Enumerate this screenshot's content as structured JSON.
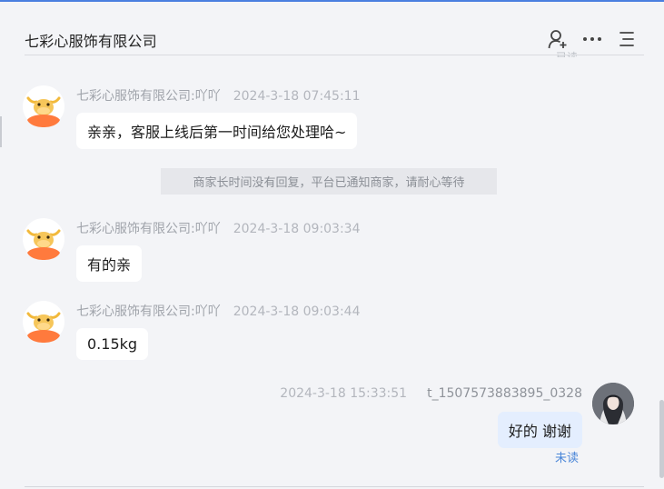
{
  "header": {
    "title": "七彩心服饰有限公司",
    "icons": [
      "add-user-icon",
      "more-icon",
      "menu-icon"
    ]
  },
  "clipped_status": "已读",
  "messages": [
    {
      "sender": "七彩心服饰有限公司:吖吖",
      "time": "2024-3-18 07:45:11",
      "text": "亲亲，客服上线后第一时间给您处理哈~"
    },
    {
      "sender": "七彩心服饰有限公司:吖吖",
      "time": "2024-3-18 09:03:34",
      "text": "有的亲"
    },
    {
      "sender": "七彩心服饰有限公司:吖吖",
      "time": "2024-3-18 09:03:44",
      "text": "0.15kg"
    }
  ],
  "system_note": "商家长时间没有回复，平台已通知商家，请耐心等待",
  "my_message": {
    "sender": "t_1507573883895_0328",
    "time": "2024-3-18 15:33:51",
    "text": "好的 谢谢",
    "status": "未读"
  },
  "colors": {
    "accent": "#4a7fe0",
    "background": "#f3f4f7",
    "my_bubble": "#e4eefe",
    "unread": "#4a86d8",
    "avatar_bull": "#ff7a3d"
  }
}
